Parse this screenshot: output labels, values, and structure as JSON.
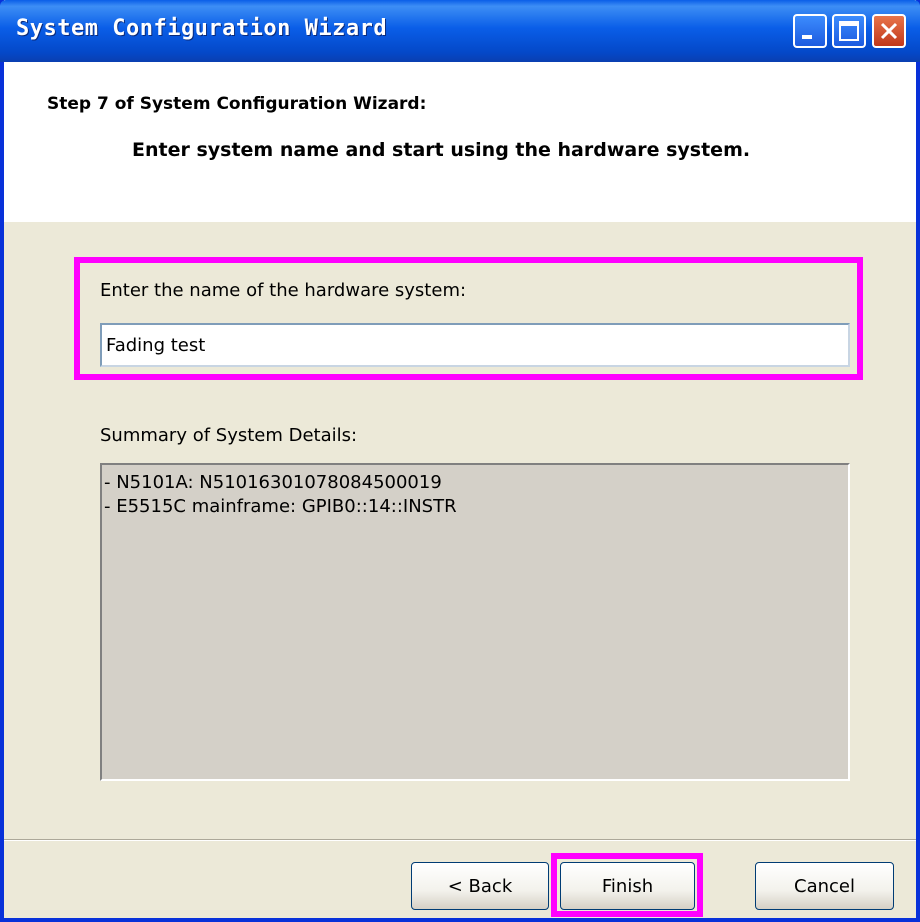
{
  "window": {
    "title": "System Configuration Wizard",
    "controls": {
      "minimize_icon": "minimize-icon",
      "maximize_icon": "maximize-icon",
      "close_icon": "close-icon"
    }
  },
  "header": {
    "step_title": "Step 7 of System Configuration Wizard:",
    "step_description": "Enter system name and start using the hardware system."
  },
  "form": {
    "name_label": "Enter the name of the hardware system:",
    "name_value": "Fading test"
  },
  "summary": {
    "label": "Summary of System Details:",
    "lines": [
      "- N5101A: N51016301078084500019",
      "- E5515C mainframe: GPIB0::14::INSTR"
    ]
  },
  "buttons": {
    "back": "< Back",
    "finish": "Finish",
    "cancel": "Cancel"
  },
  "colors": {
    "highlight": "#ff00ff",
    "titlebar": "#0a5ee8",
    "dialog_bg": "#ece9d8"
  }
}
